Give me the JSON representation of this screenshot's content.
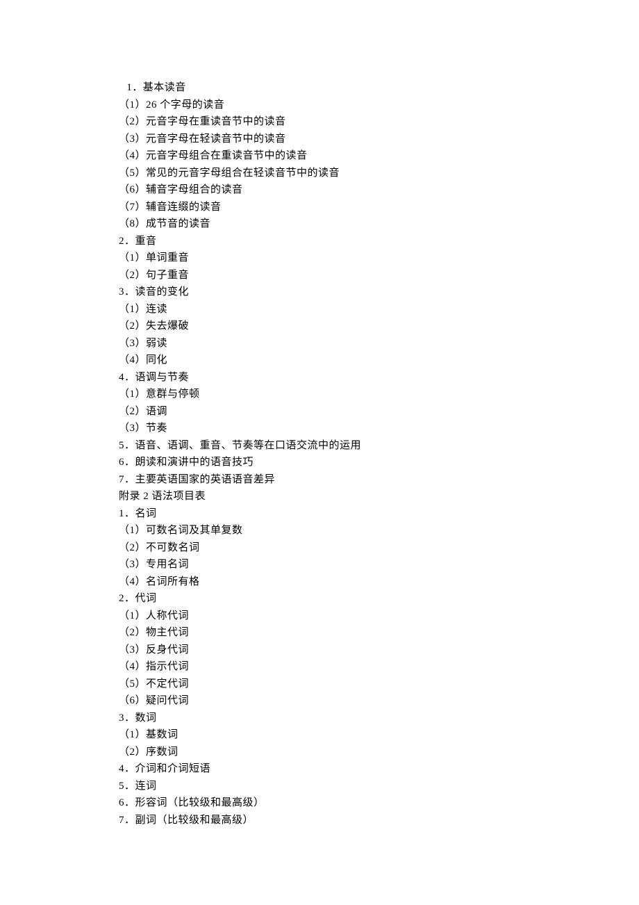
{
  "lines": [
    {
      "text": " 1．基本读音",
      "indent": 1
    },
    {
      "text": "（1）26 个字母的读音",
      "indent": 0
    },
    {
      "text": "（2）元音字母在重读音节中的读音",
      "indent": 0
    },
    {
      "text": "（3）元音字母在轻读音节中的读音",
      "indent": 0
    },
    {
      "text": "（4）元音字母组合在重读音节中的读音",
      "indent": 0
    },
    {
      "text": "（5）常见的元音字母组合在轻读音节中的读音",
      "indent": 0
    },
    {
      "text": "（6）辅音字母组合的读音",
      "indent": 0
    },
    {
      "text": "（7）辅音连缀的读音",
      "indent": 0
    },
    {
      "text": "（8）成节音的读音",
      "indent": 0
    },
    {
      "text": "2．重音",
      "indent": 0
    },
    {
      "text": "（1）单词重音",
      "indent": 0
    },
    {
      "text": "（2）句子重音",
      "indent": 0
    },
    {
      "text": "3．读音的变化",
      "indent": 0
    },
    {
      "text": "（1）连读",
      "indent": 0
    },
    {
      "text": "（2）失去爆破",
      "indent": 0
    },
    {
      "text": "（3）弱读",
      "indent": 0
    },
    {
      "text": "（4）同化",
      "indent": 0
    },
    {
      "text": "4．语调与节奏",
      "indent": 0
    },
    {
      "text": "（1）意群与停顿",
      "indent": 0
    },
    {
      "text": "（2）语调",
      "indent": 0
    },
    {
      "text": "（3）节奏",
      "indent": 0
    },
    {
      "text": "5．语音、语调、重音、节奏等在口语交流中的运用",
      "indent": 0
    },
    {
      "text": "6．朗读和演讲中的语音技巧",
      "indent": 0
    },
    {
      "text": "7．主要英语国家的英语语音差异",
      "indent": 0
    },
    {
      "text": "附录 2 语法项目表",
      "indent": 0
    },
    {
      "text": "1．名词",
      "indent": 0
    },
    {
      "text": "（1）可数名词及其单复数",
      "indent": 0
    },
    {
      "text": "（2）不可数名词",
      "indent": 0
    },
    {
      "text": "（3）专用名词",
      "indent": 0
    },
    {
      "text": "（4）名词所有格",
      "indent": 0
    },
    {
      "text": "2．代词",
      "indent": 0
    },
    {
      "text": "（1）人称代词",
      "indent": 0
    },
    {
      "text": "（2）物主代词",
      "indent": 0
    },
    {
      "text": "（3）反身代词",
      "indent": 0
    },
    {
      "text": "（4）指示代词",
      "indent": 0
    },
    {
      "text": "（5）不定代词",
      "indent": 0
    },
    {
      "text": "（6）疑问代词",
      "indent": 0
    },
    {
      "text": "3．数词",
      "indent": 0
    },
    {
      "text": "（1）基数词",
      "indent": 0
    },
    {
      "text": "（2）序数词",
      "indent": 0
    },
    {
      "text": "4．介词和介词短语",
      "indent": 0
    },
    {
      "text": "5．连词",
      "indent": 0
    },
    {
      "text": "6．形容词（比较级和最高级）",
      "indent": 0
    },
    {
      "text": "7．副词（比较级和最高级）",
      "indent": 0
    }
  ]
}
